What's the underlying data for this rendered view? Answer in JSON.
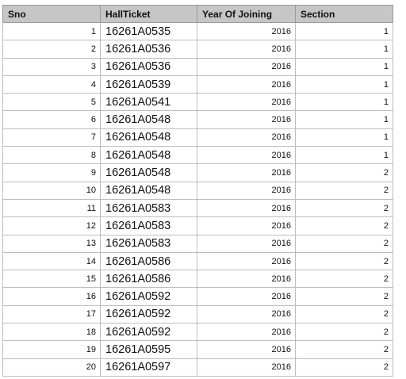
{
  "table": {
    "headers": [
      "Sno",
      "HallTicket",
      "Year Of Joining",
      "Section"
    ],
    "rows": [
      {
        "sno": "1",
        "hallticket": "16261A0535",
        "year": "2016",
        "section": "1"
      },
      {
        "sno": "2",
        "hallticket": "16261A0536",
        "year": "2016",
        "section": "1"
      },
      {
        "sno": "3",
        "hallticket": "16261A0536",
        "year": "2016",
        "section": "1"
      },
      {
        "sno": "4",
        "hallticket": "16261A0539",
        "year": "2016",
        "section": "1"
      },
      {
        "sno": "5",
        "hallticket": "16261A0541",
        "year": "2016",
        "section": "1"
      },
      {
        "sno": "6",
        "hallticket": "16261A0548",
        "year": "2016",
        "section": "1"
      },
      {
        "sno": "7",
        "hallticket": "16261A0548",
        "year": "2016",
        "section": "1"
      },
      {
        "sno": "8",
        "hallticket": "16261A0548",
        "year": "2016",
        "section": "1"
      },
      {
        "sno": "9",
        "hallticket": "16261A0548",
        "year": "2016",
        "section": "2"
      },
      {
        "sno": "10",
        "hallticket": "16261A0548",
        "year": "2016",
        "section": "2"
      },
      {
        "sno": "11",
        "hallticket": "16261A0583",
        "year": "2016",
        "section": "2"
      },
      {
        "sno": "12",
        "hallticket": "16261A0583",
        "year": "2016",
        "section": "2"
      },
      {
        "sno": "13",
        "hallticket": "16261A0583",
        "year": "2016",
        "section": "2"
      },
      {
        "sno": "14",
        "hallticket": "16261A0586",
        "year": "2016",
        "section": "2"
      },
      {
        "sno": "15",
        "hallticket": "16261A0586",
        "year": "2016",
        "section": "2"
      },
      {
        "sno": "16",
        "hallticket": "16261A0592",
        "year": "2016",
        "section": "2"
      },
      {
        "sno": "17",
        "hallticket": "16261A0592",
        "year": "2016",
        "section": "2"
      },
      {
        "sno": "18",
        "hallticket": "16261A0592",
        "year": "2016",
        "section": "2"
      },
      {
        "sno": "19",
        "hallticket": "16261A0595",
        "year": "2016",
        "section": "2"
      },
      {
        "sno": "20",
        "hallticket": "16261A0597",
        "year": "2016",
        "section": "2"
      }
    ]
  }
}
